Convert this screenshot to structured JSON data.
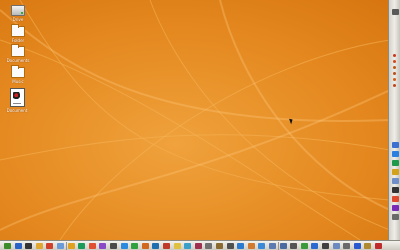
{
  "desktop": {
    "background_color": "#e58a22",
    "icons": [
      {
        "name": "drive-icon",
        "kind": "drive",
        "label": "Drive"
      },
      {
        "name": "folder-icon",
        "kind": "folder",
        "label": "Folder"
      },
      {
        "name": "folder-icon",
        "kind": "folder",
        "label": "Documents"
      },
      {
        "name": "folder-icon",
        "kind": "folder",
        "label": "Music"
      },
      {
        "name": "document-icon",
        "kind": "document",
        "label": "Document"
      }
    ]
  },
  "right_panel": {
    "icons": [
      {
        "name": "audio-icon",
        "color": "#5a5a5a",
        "shape": "square"
      },
      {
        "name": "indicator-icon",
        "color": "#c83a1e",
        "shape": "dot"
      },
      {
        "name": "indicator-icon",
        "color": "#d24a1a",
        "shape": "dot"
      },
      {
        "name": "indicator-icon",
        "color": "#c05a10",
        "shape": "dot"
      },
      {
        "name": "indicator-icon",
        "color": "#b9511a",
        "shape": "dot"
      },
      {
        "name": "indicator-icon",
        "color": "#d25f18",
        "shape": "dot"
      },
      {
        "name": "indicator-icon",
        "color": "#c0461e",
        "shape": "dot"
      },
      {
        "name": "monitor-icon",
        "color": "#3b6fd1",
        "shape": "square"
      },
      {
        "name": "network-icon",
        "color": "#2b7fe0",
        "shape": "square"
      },
      {
        "name": "chat-icon",
        "color": "#1f9a4a",
        "shape": "square"
      },
      {
        "name": "globe-icon",
        "color": "#d4a21a",
        "shape": "square"
      },
      {
        "name": "mail-icon",
        "color": "#6e8fc8",
        "shape": "square"
      },
      {
        "name": "terminal-icon",
        "color": "#333333",
        "shape": "square"
      },
      {
        "name": "calendar-icon",
        "color": "#e04a2c",
        "shape": "square"
      },
      {
        "name": "power-icon",
        "color": "#7a2ab8",
        "shape": "square"
      },
      {
        "name": "settings-icon",
        "color": "#6a6a6a",
        "shape": "square"
      }
    ]
  },
  "taskbar": {
    "icons": [
      {
        "name": "start-icon",
        "color": "#3c8c2a"
      },
      {
        "name": "browser-icon",
        "color": "#2a63c8"
      },
      {
        "name": "terminal-icon",
        "color": "#333333"
      },
      {
        "name": "folder-icon",
        "color": "#e0a830"
      },
      {
        "name": "media-icon",
        "color": "#d0402a"
      },
      {
        "name": "text-editor-icon",
        "color": "#6a9ad8"
      },
      {
        "name": "mail-icon",
        "color": "#e0a020"
      },
      {
        "name": "image-viewer-icon",
        "color": "#1b9a5a"
      },
      {
        "name": "chat-icon",
        "color": "#e05030"
      },
      {
        "name": "music-icon",
        "color": "#8a4ac8"
      },
      {
        "name": "calculator-icon",
        "color": "#4a4a4a"
      },
      {
        "name": "office-icon",
        "color": "#2a8ae0"
      },
      {
        "name": "download-icon",
        "color": "#30a040"
      },
      {
        "name": "game-icon",
        "color": "#d06820"
      },
      {
        "name": "network-icon",
        "color": "#1f6fb0"
      },
      {
        "name": "calendar-icon",
        "color": "#c03a2a"
      },
      {
        "name": "notes-icon",
        "color": "#e0c040"
      },
      {
        "name": "photo-icon",
        "color": "#3aa0c8"
      },
      {
        "name": "video-icon",
        "color": "#a03050"
      },
      {
        "name": "settings-icon",
        "color": "#707070"
      },
      {
        "name": "archive-icon",
        "color": "#8a6a30"
      },
      {
        "name": "printer-icon",
        "color": "#505050"
      },
      {
        "name": "search-icon",
        "color": "#2a7ad0"
      },
      {
        "name": "user-icon",
        "color": "#d07a30"
      },
      {
        "name": "help-icon",
        "color": "#3a8ad8"
      },
      {
        "name": "window-icon",
        "color": "#5a7ab0"
      },
      {
        "name": "window-icon",
        "color": "#4a6aa0"
      },
      {
        "name": "speaker-icon",
        "color": "#555555"
      },
      {
        "name": "battery-icon",
        "color": "#3a9a3a"
      },
      {
        "name": "wifi-icon",
        "color": "#2a6ad0"
      },
      {
        "name": "clock-icon",
        "color": "#404040"
      },
      {
        "name": "window-icon",
        "color": "#6a8ac0"
      },
      {
        "name": "trash-icon",
        "color": "#6a6a6a"
      },
      {
        "name": "bluetooth-icon",
        "color": "#2a5ad0"
      },
      {
        "name": "lock-icon",
        "color": "#b08a30"
      },
      {
        "name": "power-icon",
        "color": "#c02a2a"
      }
    ]
  }
}
